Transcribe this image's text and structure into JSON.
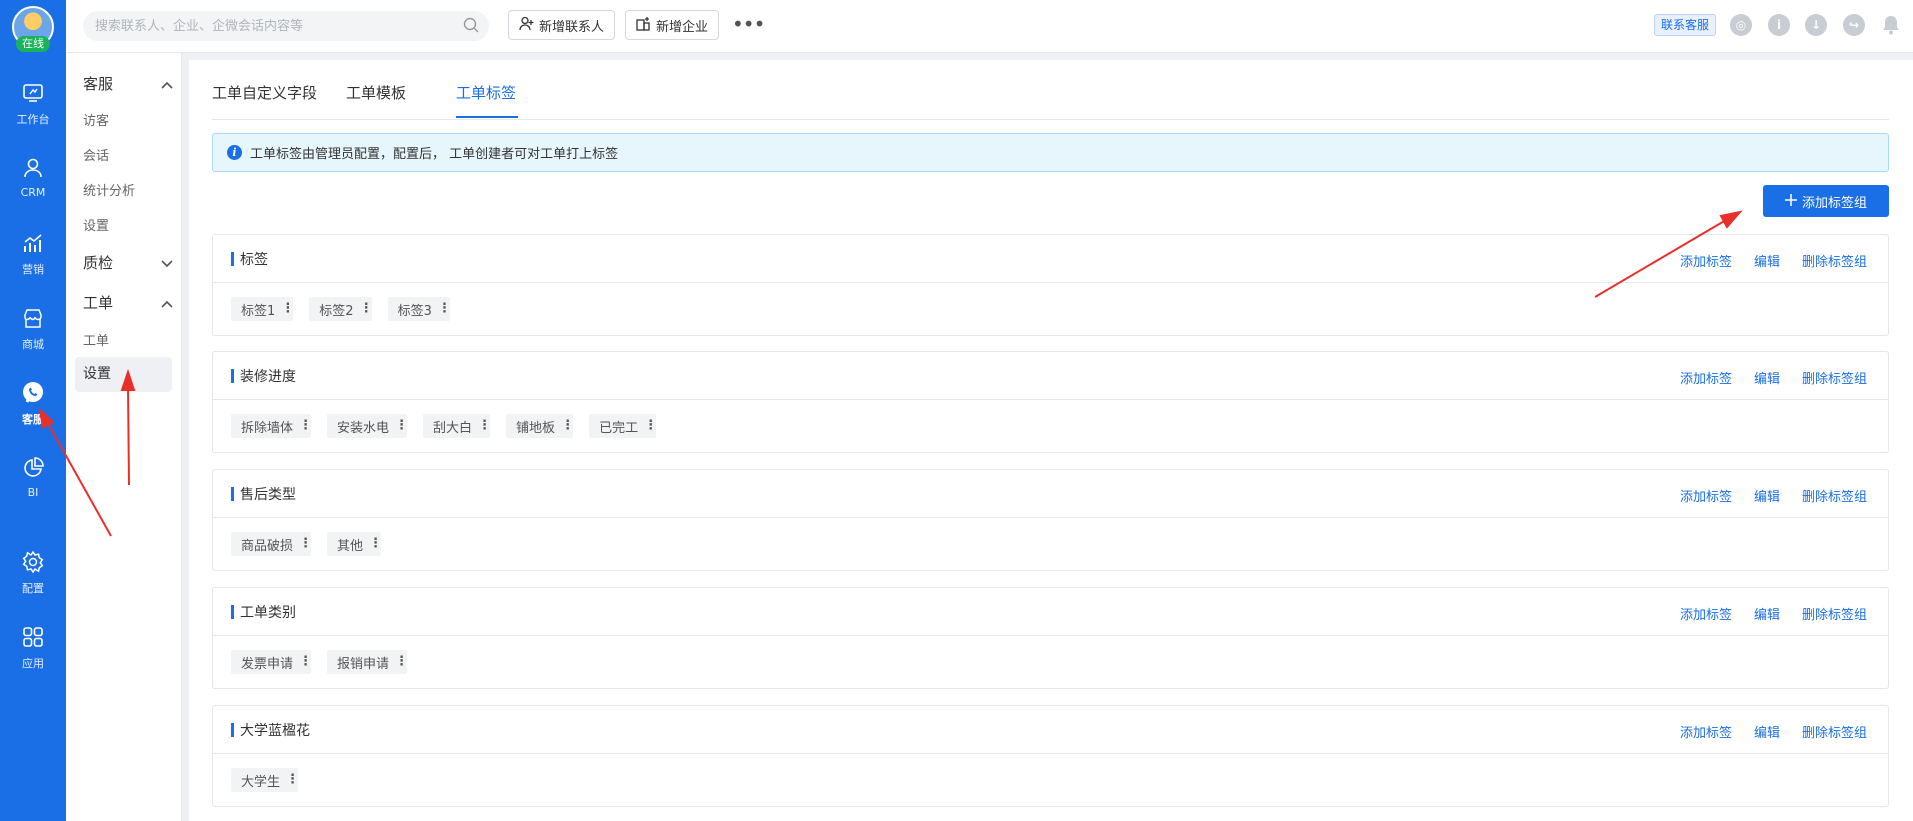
{
  "user": {
    "status": "在线"
  },
  "rail": [
    {
      "label": "工作台",
      "icon": "workbench-icon"
    },
    {
      "label": "CRM",
      "icon": "person-icon"
    },
    {
      "label": "营销",
      "icon": "chart-icon"
    },
    {
      "label": "商城",
      "icon": "store-icon"
    },
    {
      "label": "客服",
      "icon": "chat-icon",
      "active": true
    },
    {
      "label": "BI",
      "icon": "pie-icon"
    },
    {
      "label": "配置",
      "icon": "gear-icon"
    },
    {
      "label": "应用",
      "icon": "grid-icon"
    }
  ],
  "subnav": {
    "groups": [
      {
        "label": "客服",
        "expanded": true
      },
      {
        "label": "质检",
        "expanded": false
      },
      {
        "label": "工单",
        "expanded": true
      }
    ],
    "kefu_items": [
      "访客",
      "会话",
      "统计分析",
      "设置"
    ],
    "gongdan_items": [
      "工单",
      "设置"
    ]
  },
  "topbar": {
    "search_placeholder": "搜索联系人、企业、企微会话内容等",
    "add_contact": "新增联系人",
    "add_company": "新增企业",
    "contact_support": "联系客服"
  },
  "tabs": [
    "工单自定义字段",
    "工单模板",
    "工单标签"
  ],
  "active_tab": 2,
  "info_text": "工单标签由管理员配置，配置后， 工单创建者可对工单打上标签",
  "add_group_label": "添加标签组",
  "action_labels": {
    "add": "添加标签",
    "edit": "编辑",
    "delete": "删除标签组"
  },
  "groups": [
    {
      "title": "标签",
      "tags": [
        "标签1",
        "标签2",
        "标签3"
      ]
    },
    {
      "title": "装修进度",
      "tags": [
        "拆除墙体",
        "安装水电",
        "刮大白",
        "铺地板",
        "已完工"
      ]
    },
    {
      "title": "售后类型",
      "tags": [
        "商品破损",
        "其他"
      ]
    },
    {
      "title": "工单类别",
      "tags": [
        "发票申请",
        "报销申请"
      ]
    },
    {
      "title": "大学蓝楹花",
      "tags": [
        "大学生"
      ]
    }
  ],
  "colors": {
    "primary": "#1a6ee6",
    "annotation": "#e8302a"
  }
}
